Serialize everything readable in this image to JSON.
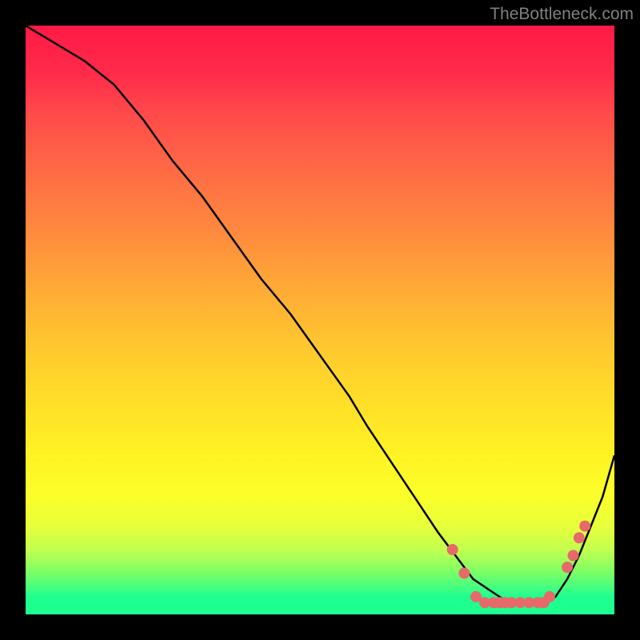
{
  "watermark": "TheBottleneck.com",
  "chart_data": {
    "type": "line",
    "title": "",
    "subtitle": "",
    "xlabel": "",
    "ylabel": "",
    "xlim": [
      0,
      100
    ],
    "ylim": [
      0,
      100
    ],
    "grid": false,
    "legend": false,
    "background_gradient": [
      "#ff1a46",
      "#ff6b45",
      "#ffab36",
      "#ffe128",
      "#c2ff4e",
      "#1eff90"
    ],
    "series": [
      {
        "name": "curve",
        "color": "#000000",
        "x": [
          0,
          5,
          10,
          15,
          20,
          25,
          30,
          35,
          40,
          45,
          50,
          55,
          58,
          62,
          66,
          70,
          73,
          76,
          79,
          82,
          85,
          88,
          90,
          92,
          94,
          96,
          98,
          100
        ],
        "values": [
          100,
          97,
          94,
          90,
          84,
          77,
          71,
          64,
          57,
          51,
          44,
          37,
          32,
          26,
          20,
          14,
          10,
          6,
          4,
          2,
          2,
          2,
          3,
          6,
          10,
          15,
          20,
          27
        ]
      }
    ],
    "markers": [
      {
        "name": "dots",
        "color": "#e66a6a",
        "radius": 7,
        "points": [
          {
            "x": 72.5,
            "y": 11
          },
          {
            "x": 74.5,
            "y": 7
          },
          {
            "x": 76.5,
            "y": 3
          },
          {
            "x": 78.0,
            "y": 2
          },
          {
            "x": 79.5,
            "y": 2
          },
          {
            "x": 80.5,
            "y": 2
          },
          {
            "x": 81.5,
            "y": 2
          },
          {
            "x": 82.5,
            "y": 2
          },
          {
            "x": 84.0,
            "y": 2
          },
          {
            "x": 85.5,
            "y": 2
          },
          {
            "x": 87.0,
            "y": 2
          },
          {
            "x": 88.0,
            "y": 2
          },
          {
            "x": 89.0,
            "y": 3
          },
          {
            "x": 92.0,
            "y": 8
          },
          {
            "x": 93.0,
            "y": 10
          },
          {
            "x": 94.0,
            "y": 13
          },
          {
            "x": 95.0,
            "y": 15
          }
        ]
      }
    ]
  }
}
